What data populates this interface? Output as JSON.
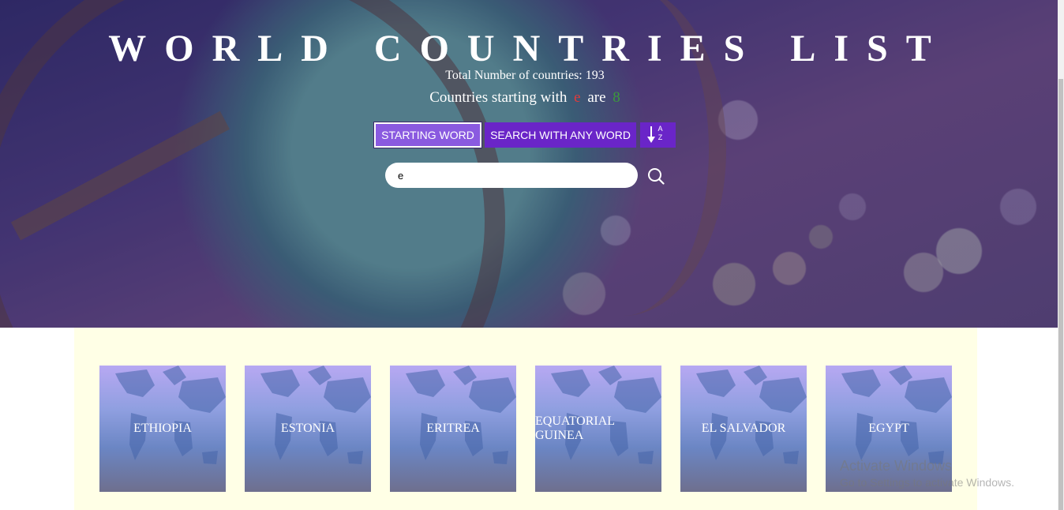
{
  "header": {
    "title": "WORLD COUNTRIES LIST",
    "total_text": "Total Number of countries: 193",
    "starting_prefix": "Countries starting with",
    "starting_letter": "e",
    "starting_mid": "are",
    "starting_count": "8"
  },
  "buttons": {
    "starting_word": "STARTING WORD",
    "search_any_word": "SEARCH WITH ANY WORD",
    "sort_icon": "sort-a-z-icon"
  },
  "search": {
    "value": "e",
    "icon": "search-icon"
  },
  "countries": [
    "ETHIOPIA",
    "ESTONIA",
    "ERITREA",
    "EQUATORIAL GUINEA",
    "EL SALVADOR",
    "EGYPT"
  ],
  "watermark": {
    "title": "Activate Windows",
    "subtitle": "Go to Settings to activate Windows."
  },
  "colors": {
    "button_active": "#8a5ae0",
    "button": "#6a25c8",
    "list_background": "#ffffe6",
    "letter_color": "#e03b3b",
    "count_color": "#3b9a3b"
  }
}
